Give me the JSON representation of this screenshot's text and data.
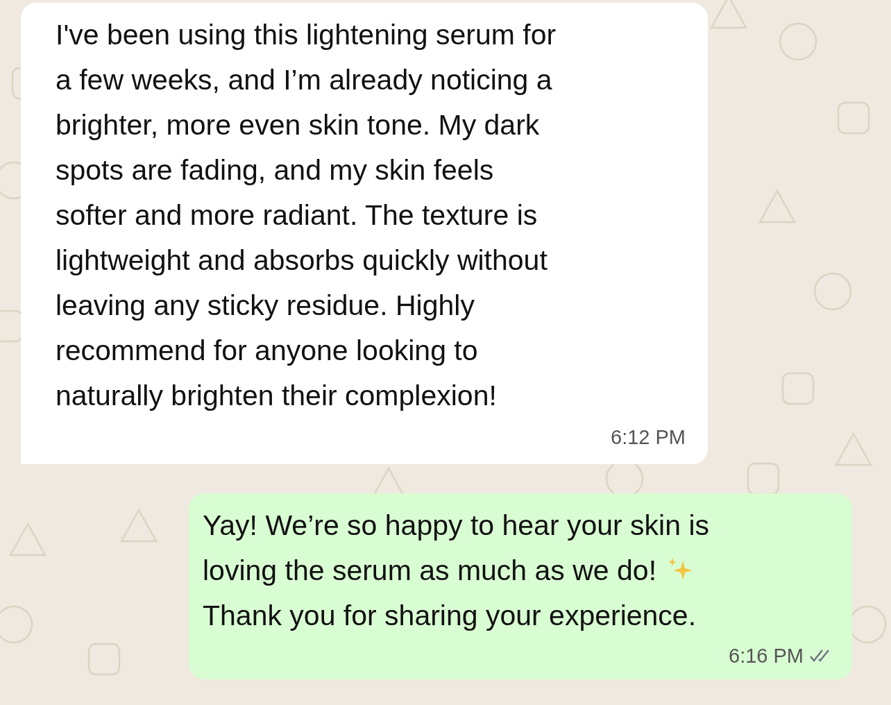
{
  "messages": [
    {
      "kind": "incoming",
      "text": "I've been using this lightening serum for\na few weeks, and I’m already noticing a\nbrighter, more even skin tone. My dark\nspots are fading, and my skin feels\nsofter and more radiant. The texture is\nlightweight and absorbs quickly without\nleaving any sticky residue. Highly\nrecommend for anyone looking to\nnaturally brighten their complexion!",
      "time": "6:12 PM"
    },
    {
      "kind": "outgoing",
      "lines": [
        "Yay! We’re so happy to hear your skin is",
        "loving the serum as much as we do!",
        "Thank you for sharing your experience."
      ],
      "time": "6:16 PM"
    }
  ]
}
